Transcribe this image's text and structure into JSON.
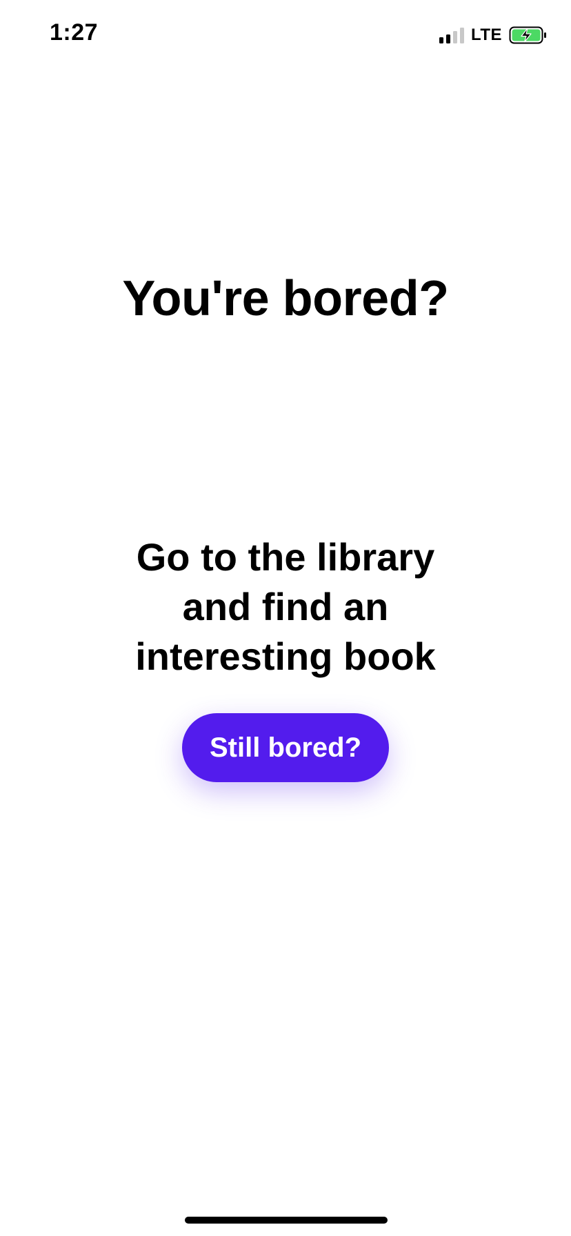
{
  "status_bar": {
    "time": "1:27",
    "network": "LTE",
    "signal_bars_active": 2,
    "signal_bars_total": 4,
    "battery_charging": true,
    "battery_color": "#4cd964"
  },
  "main": {
    "headline": "You're bored?",
    "suggestion": "Go to the library and find an interesting book",
    "button_label": "Still bored?"
  },
  "colors": {
    "accent": "#531ced",
    "text": "#000000",
    "background": "#ffffff"
  }
}
